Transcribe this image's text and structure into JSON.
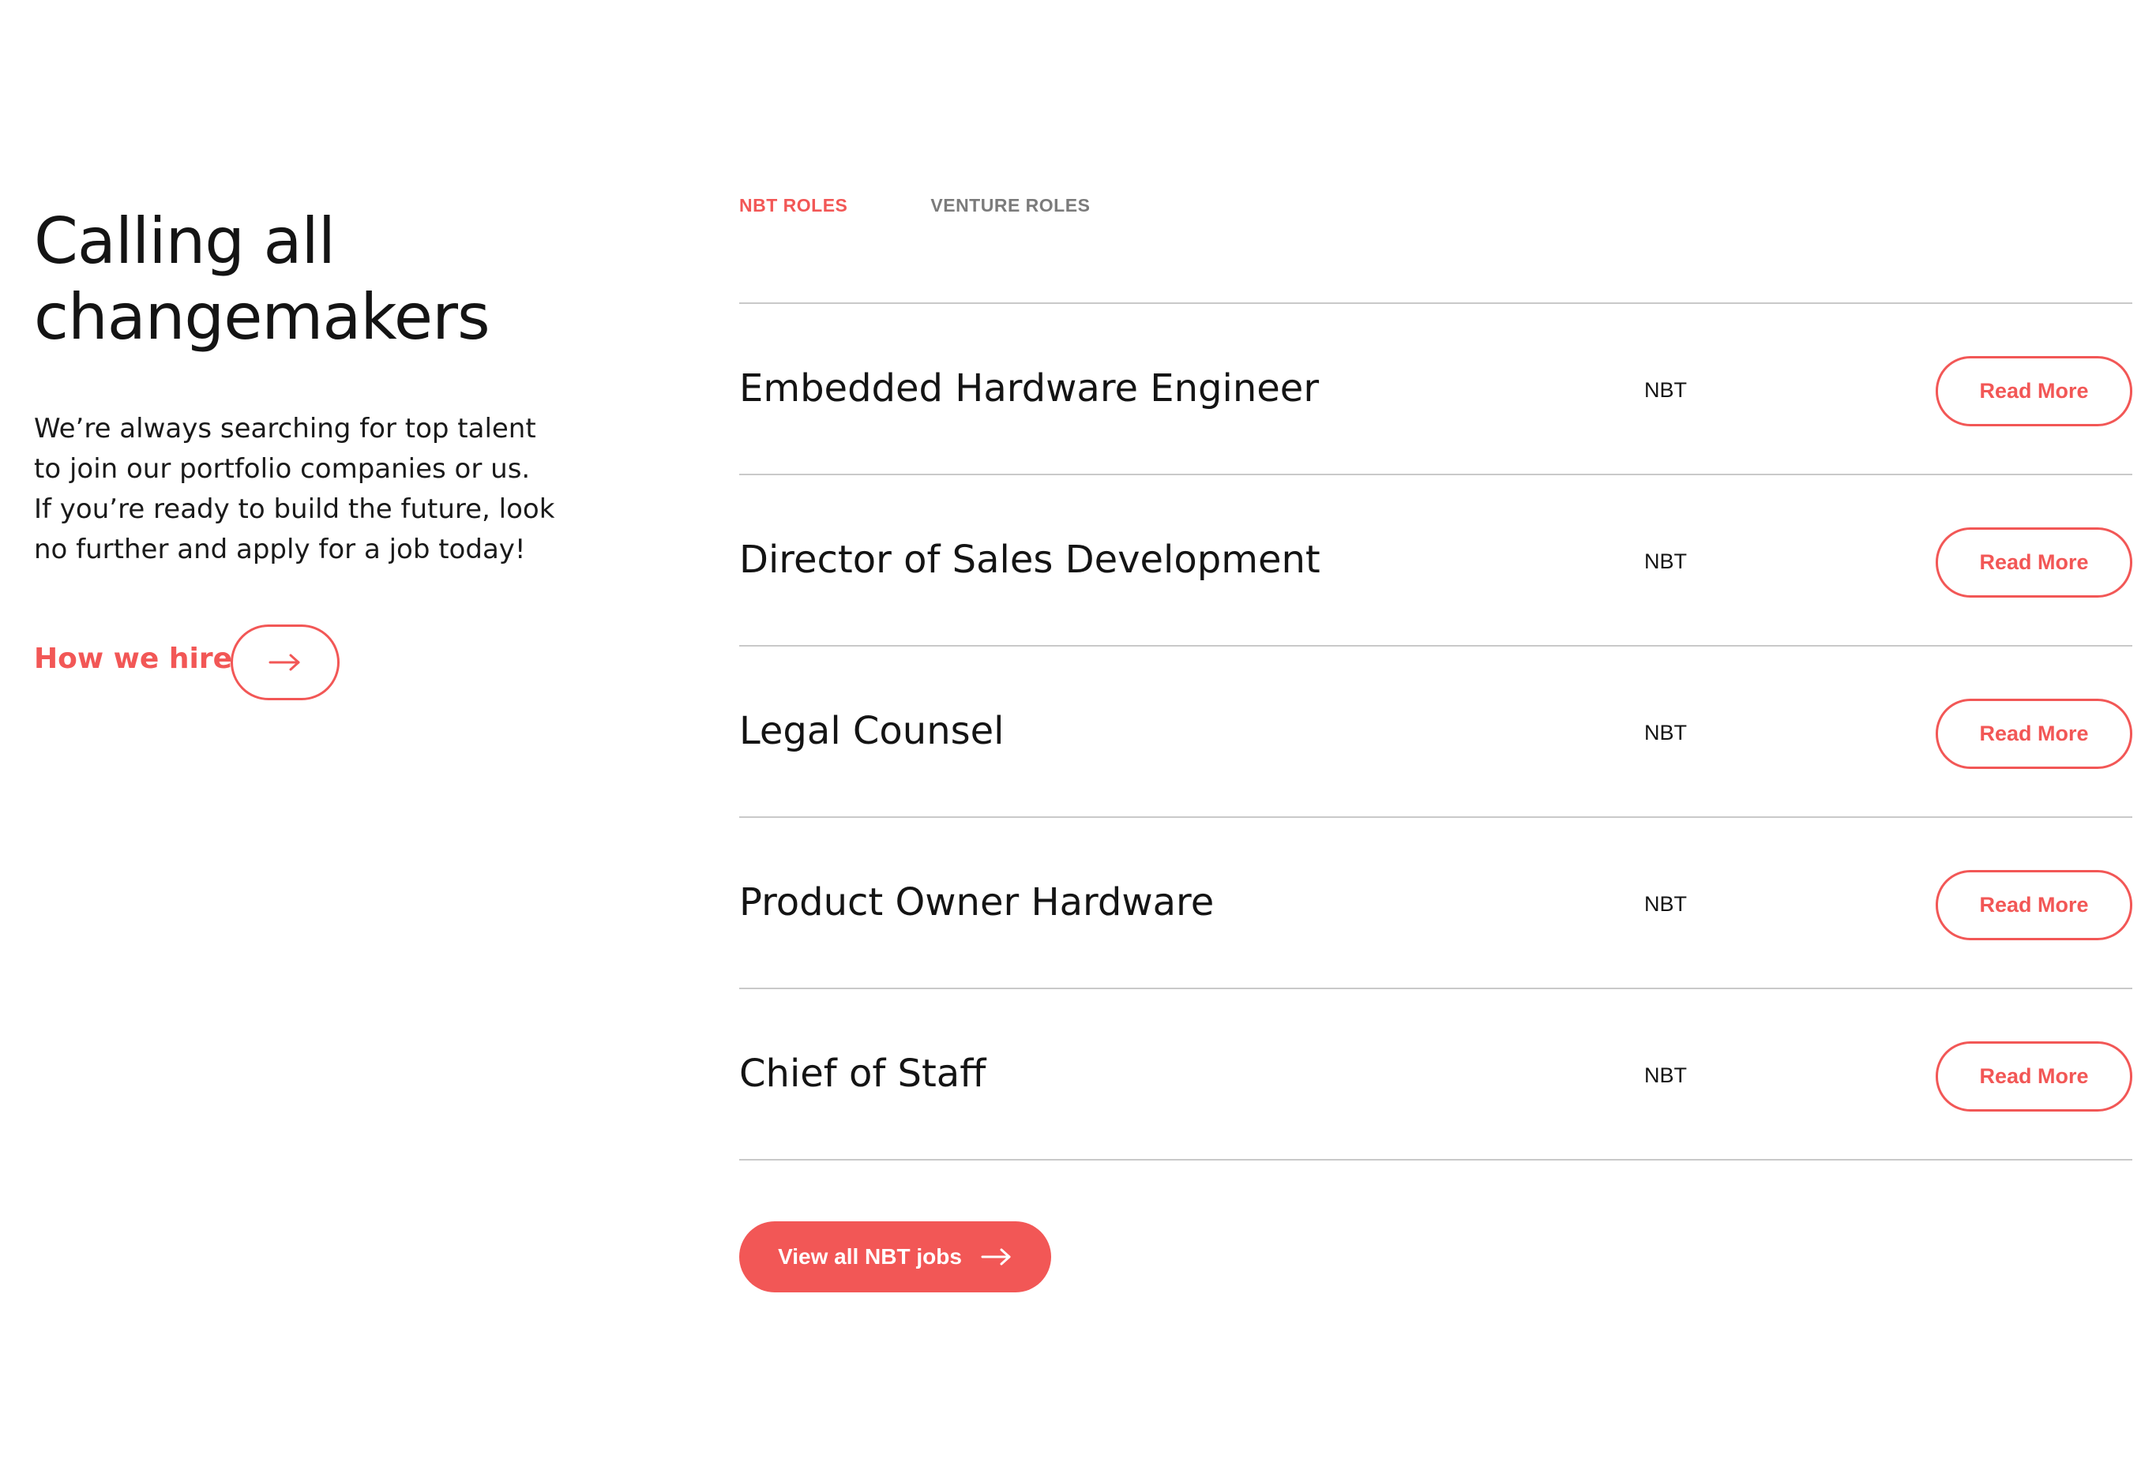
{
  "hero": {
    "heading_line1": "Calling all",
    "heading_line2": "changemakers",
    "intro_line1": "We’re always searching for top talent",
    "intro_line2": "to join our portfolio companies or us.",
    "intro_line3": "If you’re ready to build the future, look",
    "intro_line4": "no further and apply for a job today!",
    "how_we_hire_label": "How we hire",
    "how_we_hire_icon": "arrow-right-icon"
  },
  "tabs": [
    {
      "label": "NBT ROLES",
      "active": true
    },
    {
      "label": "VENTURE ROLES",
      "active": false
    }
  ],
  "jobs": [
    {
      "title": "Embedded Hardware Engineer",
      "company": "NBT",
      "action": "Read More"
    },
    {
      "title": "Director of Sales Development",
      "company": "NBT",
      "action": "Read More"
    },
    {
      "title": "Legal Counsel",
      "company": "NBT",
      "action": "Read More"
    },
    {
      "title": "Product Owner Hardware",
      "company": "NBT",
      "action": "Read More"
    },
    {
      "title": "Chief of Staff",
      "company": "NBT",
      "action": "Read More"
    }
  ],
  "view_all": {
    "label": "View all NBT jobs",
    "icon": "arrow-right-icon"
  },
  "colors": {
    "accent": "#f25756",
    "text": "#141414",
    "muted": "#7b7b7b",
    "divider": "#c9c9c9",
    "background": "#ffffff"
  }
}
